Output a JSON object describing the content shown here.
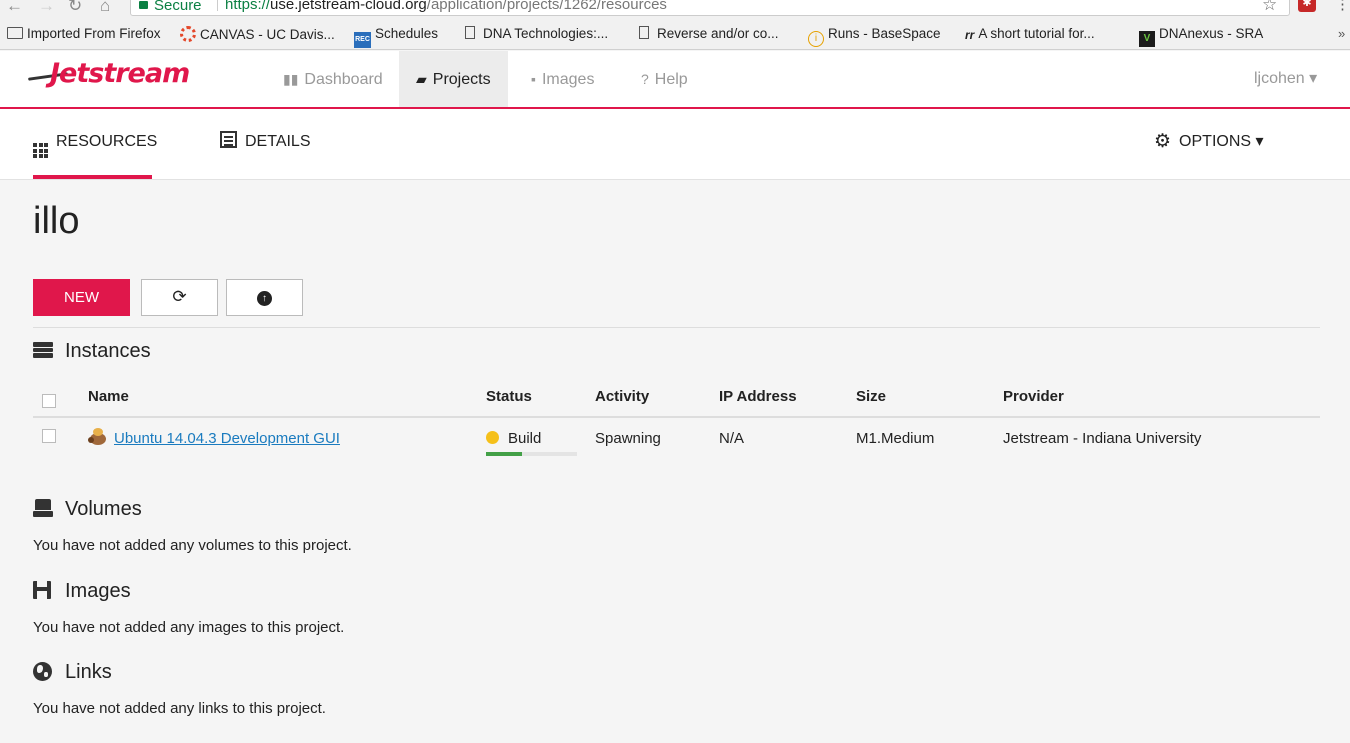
{
  "browser": {
    "secure_label": "Secure",
    "url_scheme": "https://",
    "url_host": "use.jetstream-cloud.org",
    "url_path": "/application/projects/1262/resources",
    "bookmarks": [
      "Imported From Firefox",
      "CANVAS - UC Davis...",
      "Schedules",
      "DNA Technologies:...",
      "Reverse and/or co...",
      "Runs - BaseSpace",
      "A short tutorial for...",
      "DNAnexus - SRA"
    ],
    "more": "»"
  },
  "app": {
    "logo": "Jetstream",
    "nav": [
      "Dashboard",
      "Projects",
      "Images",
      "Help"
    ],
    "active_nav": "Projects",
    "user": "ljcohen ▾",
    "accent": "#e0174b"
  },
  "subnav": {
    "tabs": [
      "RESOURCES",
      "DETAILS"
    ],
    "active": "RESOURCES",
    "options": "OPTIONS ▾"
  },
  "project": {
    "title": "illo",
    "new_button": "NEW",
    "refresh_icon": "refresh-icon",
    "upload_icon": "upload-icon"
  },
  "instances": {
    "heading": "Instances",
    "columns": [
      "Name",
      "Status",
      "Activity",
      "IP Address",
      "Size",
      "Provider"
    ],
    "rows": [
      {
        "name": "Ubuntu 14.04.3 Development GUI",
        "status": "Build",
        "progress": 0.4,
        "activity": "Spawning",
        "ip": "N/A",
        "size": "M1.Medium",
        "provider": "Jetstream - Indiana University"
      }
    ]
  },
  "volumes": {
    "heading": "Volumes",
    "empty": "You have not added any volumes to this project."
  },
  "images": {
    "heading": "Images",
    "empty": "You have not added any images to this project."
  },
  "links": {
    "heading": "Links",
    "empty": "You have not added any links to this project."
  }
}
